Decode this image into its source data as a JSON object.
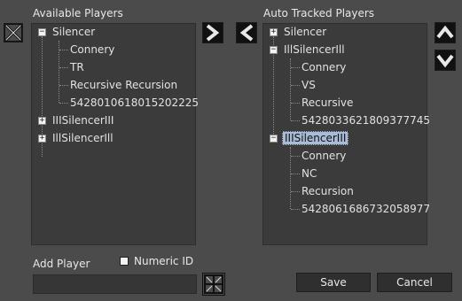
{
  "available": {
    "title": "Available Players",
    "tree": [
      {
        "label": "Silencer",
        "expander": "−"
      },
      {
        "label": "Connery"
      },
      {
        "label": "TR"
      },
      {
        "label": "Recursive Recursion"
      },
      {
        "label": "5428010618015202225"
      },
      {
        "label": "IIISilencerIII",
        "expander": "+"
      },
      {
        "label": "IllSilencerIll",
        "expander": "+"
      }
    ]
  },
  "tracked": {
    "title": "Auto Tracked Players",
    "tree": [
      {
        "label": "Silencer",
        "expander": "+"
      },
      {
        "label": "IllSilencerIll",
        "expander": "−"
      },
      {
        "label": "Connery"
      },
      {
        "label": "VS"
      },
      {
        "label": "Recursive"
      },
      {
        "label": "5428033621809377745"
      },
      {
        "label": "IIISilencerIII",
        "expander": "−"
      },
      {
        "label": "Connery"
      },
      {
        "label": "NC"
      },
      {
        "label": "Recursion"
      },
      {
        "label": "5428061686732058977"
      }
    ]
  },
  "add_player": {
    "label": "Add Player",
    "value": "",
    "numeric_label": "Numeric ID",
    "numeric_checked": false
  },
  "buttons": {
    "save": "Save",
    "cancel": "Cancel"
  },
  "icons": {
    "clear": "clear-x-icon",
    "move_right": "chevron-right-icon",
    "move_left": "chevron-left-icon",
    "up": "chevron-up-icon",
    "down": "chevron-down-icon",
    "grid": "grid-icon"
  }
}
